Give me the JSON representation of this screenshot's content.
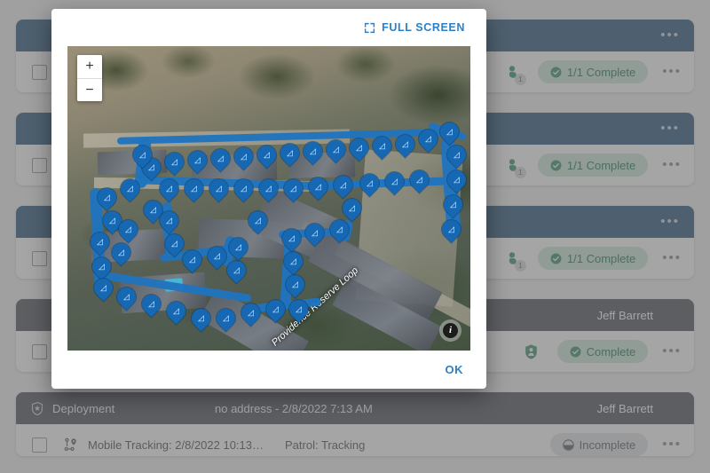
{
  "background": {
    "cards": [
      {
        "header": {
          "title": "",
          "subtitle": "",
          "owner": "",
          "menu": "•••",
          "style": "blue"
        },
        "row": {
          "checkbox": "",
          "title": "",
          "second": "",
          "person_count": "1",
          "badge": "1/1 Complete",
          "badge_state": "ok",
          "menu": "•••"
        }
      },
      {
        "header": {
          "title": "",
          "subtitle": "",
          "owner": "",
          "menu": "•••",
          "style": "blue"
        },
        "row": {
          "checkbox": "",
          "title": "",
          "second": "",
          "person_count": "1",
          "badge": "1/1 Complete",
          "badge_state": "ok",
          "menu": "•••"
        }
      },
      {
        "header": {
          "title": "",
          "subtitle": "",
          "owner": "",
          "menu": "•••",
          "style": "blue"
        },
        "row": {
          "checkbox": "",
          "title": "",
          "second": "",
          "person_count": "1",
          "badge": "1/1 Complete",
          "badge_state": "ok",
          "menu": "•••"
        }
      },
      {
        "header": {
          "title": "",
          "subtitle": "",
          "owner": "Jeff Barrett",
          "menu": "",
          "style": "gray"
        },
        "row": {
          "checkbox": "",
          "title": "",
          "second": "",
          "person_count": "",
          "badge": "Complete",
          "badge_state": "ok",
          "menu": "•••"
        }
      },
      {
        "header": {
          "title": "Deployment",
          "subtitle": "no address - 2/8/2022 7:13 AM",
          "owner": "Jeff Barrett",
          "menu": "",
          "style": "gray"
        },
        "row": {
          "checkbox": "",
          "title": "Mobile Tracking: 2/8/2022 10:13…",
          "second": "Patrol: Tracking",
          "person_count": "",
          "badge": "Incomplete",
          "badge_state": "no",
          "menu": "•••"
        }
      }
    ]
  },
  "modal": {
    "fullscreen_label": "FULL SCREEN",
    "ok_label": "OK",
    "map": {
      "zoom_in": "+",
      "zoom_out": "−",
      "info": "i",
      "road_label": "Providence Reserve Loop",
      "marker_icon": "footsteps-icon",
      "marker_glyph": "☸",
      "marker_count": 52,
      "track_color": "#1f74bd",
      "marker_color": "#1668b3"
    }
  },
  "colors": {
    "header_blue": "#1b4b72",
    "header_gray": "#3f4650",
    "accent_link": "#2f7fc4",
    "badge_ok_bg": "#c9e7d5",
    "badge_ok_fg": "#17704a",
    "badge_no_bg": "#dfe1e4",
    "badge_no_fg": "#4b5059"
  }
}
